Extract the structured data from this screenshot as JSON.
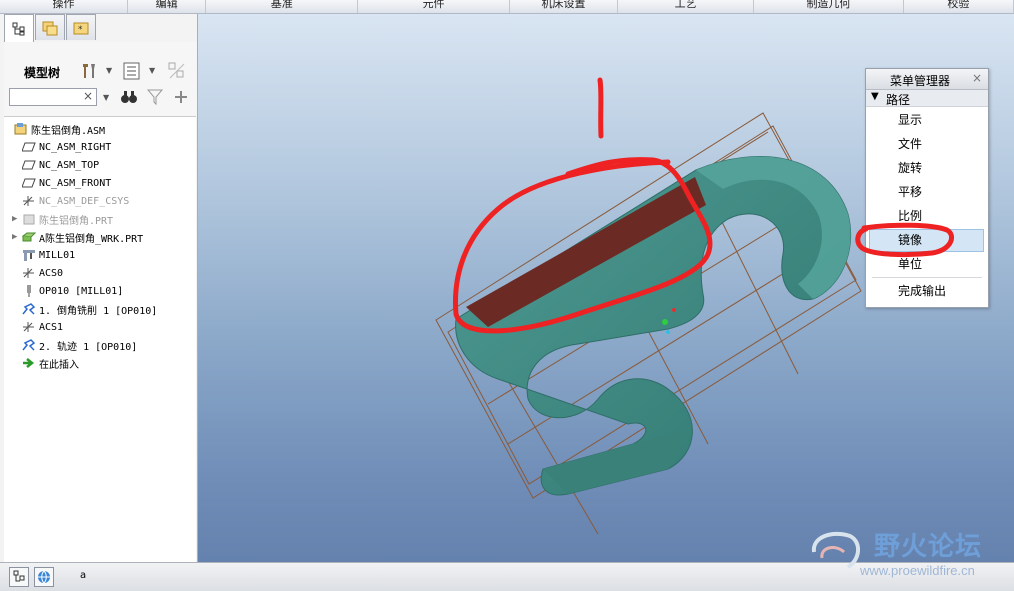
{
  "ribbon": {
    "groups": [
      "操作",
      "编辑",
      "基准",
      "元件",
      "机床设置",
      "工艺",
      "制造几何",
      "校验"
    ]
  },
  "left_panel": {
    "tabs": [
      {
        "icon": "model-tree-icon"
      },
      {
        "icon": "folder-browser-icon"
      },
      {
        "icon": "favorites-icon"
      }
    ],
    "model_tree_label": "模型树",
    "search_clear": "×"
  },
  "tree": [
    {
      "label": "陈生铝倒角.ASM",
      "icon": "assembly-icon",
      "indent": 0,
      "expander": false,
      "dim": false
    },
    {
      "label": "NC_ASM_RIGHT",
      "icon": "datum-plane-icon",
      "indent": 1,
      "expander": false,
      "dim": false
    },
    {
      "label": "NC_ASM_TOP",
      "icon": "datum-plane-icon",
      "indent": 1,
      "expander": false,
      "dim": false
    },
    {
      "label": "NC_ASM_FRONT",
      "icon": "datum-plane-icon",
      "indent": 1,
      "expander": false,
      "dim": false
    },
    {
      "label": "NC_ASM_DEF_CSYS",
      "icon": "csys-icon",
      "indent": 1,
      "expander": false,
      "dim": true
    },
    {
      "label": "陈生铝倒角.PRT",
      "icon": "part-icon",
      "indent": 1,
      "expander": true,
      "dim": true
    },
    {
      "label": "A陈生铝倒角_WRK.PRT",
      "icon": "workpiece-icon",
      "indent": 1,
      "expander": true,
      "dim": false
    },
    {
      "label": "MILL01",
      "icon": "mill-machine-icon",
      "indent": 1,
      "expander": false,
      "dim": false
    },
    {
      "label": "ACS0",
      "icon": "csys-icon",
      "indent": 1,
      "expander": false,
      "dim": false
    },
    {
      "label": "OP010 [MILL01]",
      "icon": "operation-icon",
      "indent": 1,
      "expander": false,
      "dim": false
    },
    {
      "label": "1. 倒角铣削 1 [OP010]",
      "icon": "toolpath-icon",
      "indent": 1,
      "expander": false,
      "dim": false
    },
    {
      "label": "ACS1",
      "icon": "csys-icon",
      "indent": 1,
      "expander": false,
      "dim": false
    },
    {
      "label": "2. 轨迹 1 [OP010]",
      "icon": "toolpath-icon",
      "indent": 1,
      "expander": false,
      "dim": false
    },
    {
      "label": "在此插入",
      "icon": "insert-here-arrow-icon",
      "indent": 1,
      "expander": false,
      "dim": false
    }
  ],
  "menu_manager": {
    "title": "菜单管理器",
    "close": "×",
    "path_label": "路径",
    "items": [
      {
        "label": "显示",
        "selected": false
      },
      {
        "label": "文件",
        "selected": false
      },
      {
        "label": "旋转",
        "selected": false
      },
      {
        "label": "平移",
        "selected": false
      },
      {
        "label": "比例",
        "selected": false
      },
      {
        "label": "镜像",
        "selected": true
      },
      {
        "label": "单位",
        "selected": false
      },
      {
        "label": "完成输出",
        "selected": false
      }
    ]
  },
  "annotation": {
    "number": "1",
    "color": "#ee2222"
  },
  "model": {
    "body_color": "#3f8a83",
    "highlight_color": "#6b2b24",
    "wire_color": "#8a5a3a"
  },
  "status": {
    "text": "a"
  },
  "watermark": {
    "title": "野火论坛",
    "url": "www.proewildfire.cn"
  }
}
